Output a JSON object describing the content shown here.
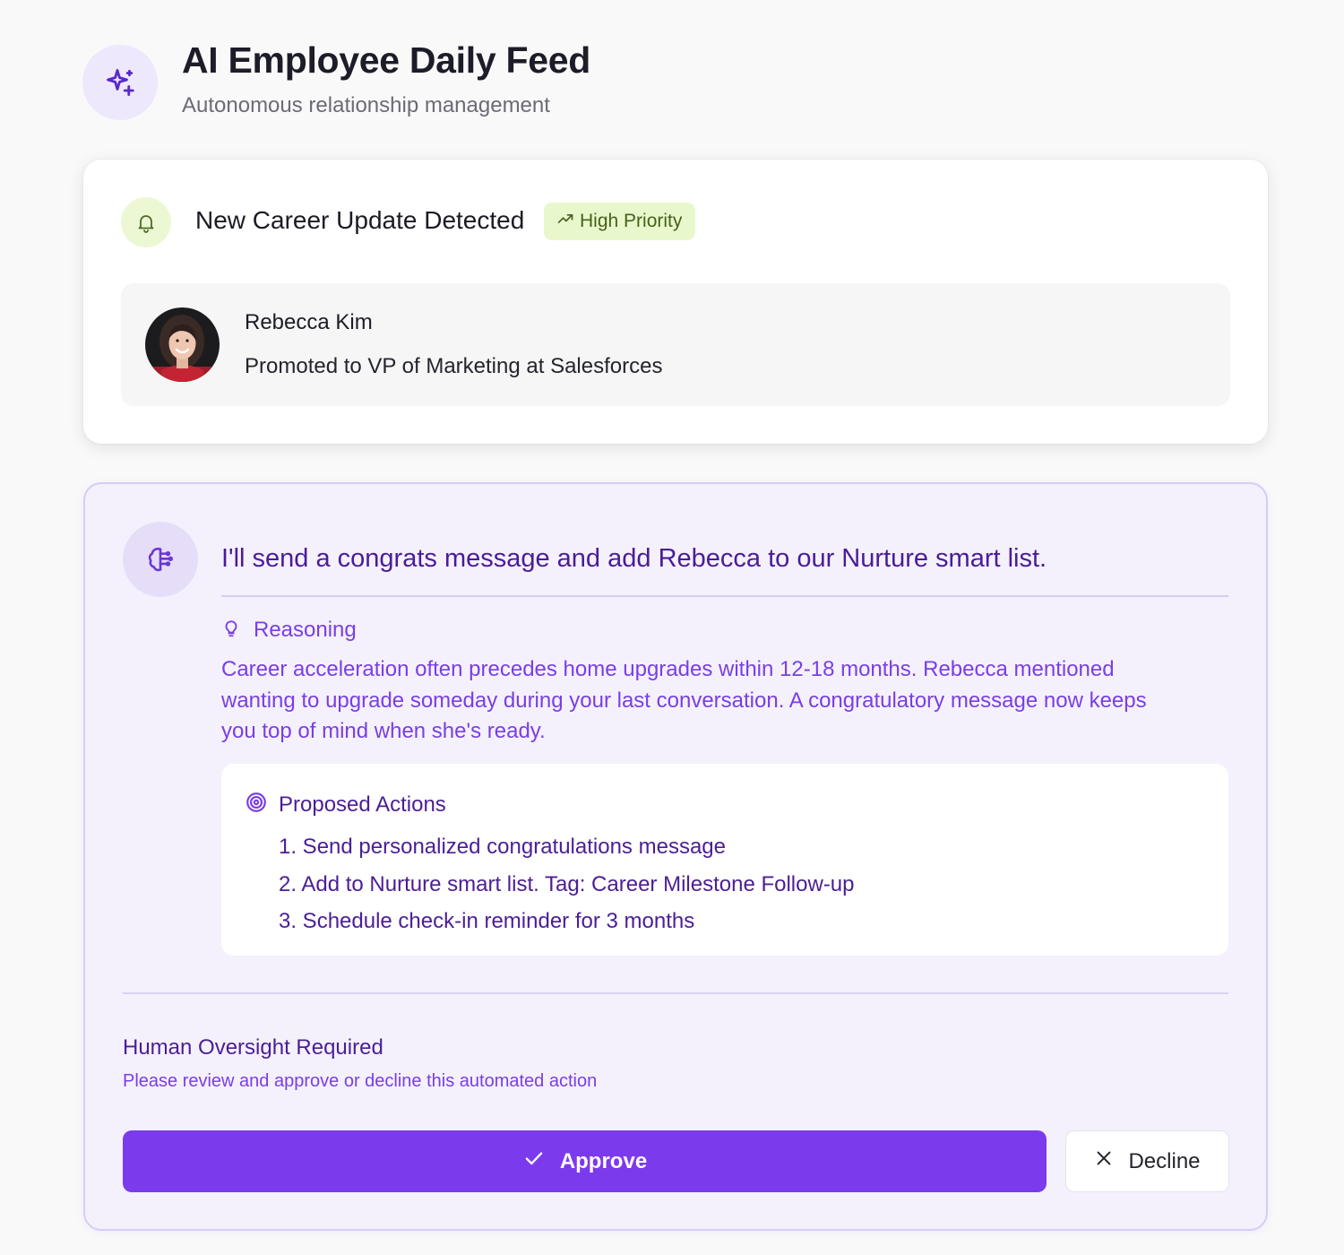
{
  "header": {
    "icon": "sparkles-icon",
    "title": "AI Employee Daily Feed",
    "subtitle": "Autonomous relationship management"
  },
  "update_card": {
    "icon": "bell-icon",
    "title": "New Career Update Detected",
    "badge": {
      "icon": "trending-up-icon",
      "label": "High Priority"
    },
    "person": {
      "name": "Rebecca Kim",
      "update": "Promoted to VP of Marketing at Salesforces"
    }
  },
  "ai_card": {
    "icon": "brain-icon",
    "message": "I'll send a congrats message and add Rebecca to our Nurture smart list.",
    "reasoning": {
      "icon": "lightbulb-icon",
      "label": "Reasoning",
      "lines": [
        "Career acceleration often precedes home upgrades within 12-18 months. Rebecca mentioned",
        "wanting to upgrade someday during your last conversation. A congratulatory message now keeps",
        "you top of mind when she's ready."
      ]
    },
    "proposed_actions": {
      "icon": "target-icon",
      "label": "Proposed Actions",
      "items": [
        "1. Send personalized congratulations message",
        "2. Add to Nurture smart list. Tag: Career Milestone Follow-up",
        "3. Schedule check-in reminder for 3 months"
      ]
    },
    "oversight": {
      "title": "Human Oversight Required",
      "subtitle": "Please review and approve or decline this automated action"
    },
    "approve_label": "Approve",
    "decline_label": "Decline"
  },
  "colors": {
    "accent": "#7c3aed",
    "accent_text": "#4b1e96",
    "priority_bg": "#e9f8cc",
    "priority_text": "#45611a"
  }
}
